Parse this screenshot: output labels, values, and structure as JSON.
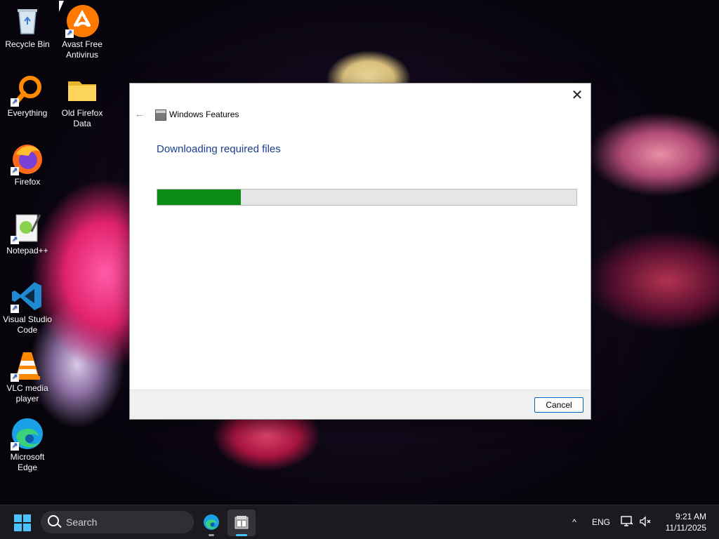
{
  "desktop": {
    "icons": [
      {
        "label": "Recycle Bin",
        "icon": "recycle-bin-icon",
        "shortcut": false
      },
      {
        "label": "Avast Free Antivirus",
        "icon": "avast-icon",
        "shortcut": true
      },
      {
        "label": "Everything",
        "icon": "everything-search-icon",
        "shortcut": true
      },
      {
        "label": "Old Firefox Data",
        "icon": "folder-icon",
        "shortcut": false
      },
      {
        "label": "Firefox",
        "icon": "firefox-icon",
        "shortcut": true
      },
      {
        "label": "Notepad++",
        "icon": "notepadplusplus-icon",
        "shortcut": true
      },
      {
        "label": "Visual Studio Code",
        "icon": "vscode-icon",
        "shortcut": true
      },
      {
        "label": "VLC media player",
        "icon": "vlc-icon",
        "shortcut": true
      },
      {
        "label": "Microsoft Edge",
        "icon": "edge-icon",
        "shortcut": true
      }
    ]
  },
  "dialog": {
    "title": "Windows Features",
    "heading": "Downloading required files",
    "progress_fraction": 0.2,
    "cancel_label": "Cancel",
    "close_glyph": "✕",
    "back_glyph": "←",
    "accent": "#0b8a14"
  },
  "taskbar": {
    "search_placeholder": "Search",
    "tray": {
      "chevron": "^",
      "language": "ENG",
      "time": "9:21 AM",
      "date": "11/11/2025"
    }
  }
}
